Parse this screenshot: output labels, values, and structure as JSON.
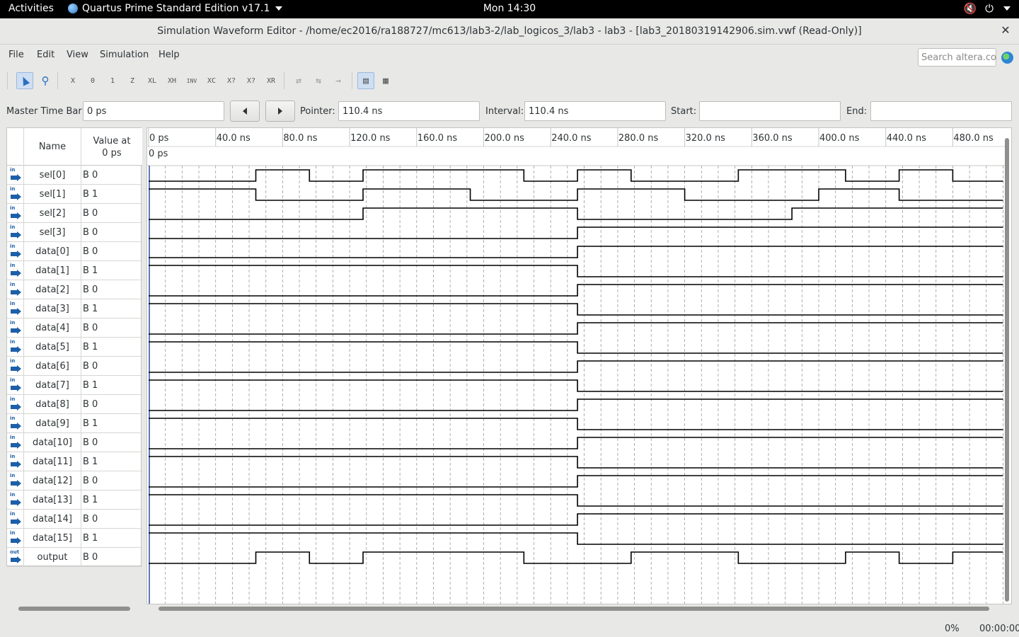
{
  "topbar": {
    "activities": "Activities",
    "app_name": "Quartus Prime Standard Edition v17.1",
    "clock": "Mon 14:30"
  },
  "window": {
    "title": "Simulation Waveform Editor - /home/ec2016/ra188727/mc613/lab3-2/lab_logicos_3/lab3 - lab3 - [lab3_20180319142906.sim.vwf (Read-Only)]",
    "close": "✕"
  },
  "menu": {
    "items": [
      "File",
      "Edit",
      "View",
      "Simulation",
      "Help"
    ],
    "search_placeholder": "Search altera.co..."
  },
  "toolbar": {
    "icons": [
      "selection-tool-icon",
      "zoom-tool-icon",
      "force-unknown-icon",
      "force-low-icon",
      "force-high-icon",
      "force-high-impedance-icon",
      "force-weak-low-icon",
      "force-weak-high-icon",
      "invert-icon",
      "count-value-icon",
      "overwrite-clock-icon",
      "random-values-icon",
      "arbitrary-value-icon",
      "snap-to-grid-icon",
      "sort-icon",
      "insert-node-icon",
      "delete-node-icon",
      "grid-options-icon"
    ],
    "glyphs": [
      "",
      "",
      "X",
      "0",
      "1",
      "Z",
      "XL",
      "XH",
      "INV",
      "XC",
      "X?",
      "X?",
      "XR",
      "⇄",
      "⇆",
      "→",
      "▤",
      "▦"
    ]
  },
  "timebar": {
    "master_label": "Master Time Bar:",
    "master_value": "0 ps",
    "pointer_label": "Pointer:",
    "pointer_value": "110.4 ns",
    "interval_label": "Interval:",
    "interval_value": "110.4 ns",
    "start_label": "Start:",
    "start_value": "",
    "end_label": "End:",
    "end_value": ""
  },
  "signal_table": {
    "name_header": "Name",
    "value_header_line1": "Value at",
    "value_header_line2": "0 ps",
    "signals": [
      {
        "dir": "in",
        "name": "sel[0]",
        "value": "B 0"
      },
      {
        "dir": "in",
        "name": "sel[1]",
        "value": "B 1"
      },
      {
        "dir": "in",
        "name": "sel[2]",
        "value": "B 0"
      },
      {
        "dir": "in",
        "name": "sel[3]",
        "value": "B 0"
      },
      {
        "dir": "in",
        "name": "data[0]",
        "value": "B 0"
      },
      {
        "dir": "in",
        "name": "data[1]",
        "value": "B 1"
      },
      {
        "dir": "in",
        "name": "data[2]",
        "value": "B 0"
      },
      {
        "dir": "in",
        "name": "data[3]",
        "value": "B 1"
      },
      {
        "dir": "in",
        "name": "data[4]",
        "value": "B 0"
      },
      {
        "dir": "in",
        "name": "data[5]",
        "value": "B 1"
      },
      {
        "dir": "in",
        "name": "data[6]",
        "value": "B 0"
      },
      {
        "dir": "in",
        "name": "data[7]",
        "value": "B 1"
      },
      {
        "dir": "in",
        "name": "data[8]",
        "value": "B 0"
      },
      {
        "dir": "in",
        "name": "data[9]",
        "value": "B 1"
      },
      {
        "dir": "in",
        "name": "data[10]",
        "value": "B 0"
      },
      {
        "dir": "in",
        "name": "data[11]",
        "value": "B 1"
      },
      {
        "dir": "in",
        "name": "data[12]",
        "value": "B 0"
      },
      {
        "dir": "in",
        "name": "data[13]",
        "value": "B 1"
      },
      {
        "dir": "in",
        "name": "data[14]",
        "value": "B 0"
      },
      {
        "dir": "in",
        "name": "data[15]",
        "value": "B 1"
      },
      {
        "dir": "out",
        "name": "output",
        "value": "B 0"
      }
    ]
  },
  "waveform": {
    "time_unit": "ns",
    "time_range": [
      0,
      510
    ],
    "ticks": [
      "0 ps",
      "40.0 ns",
      "80.0 ns",
      "120.0 ns",
      "160.0 ns",
      "200.0 ns",
      "240.0 ns",
      "280.0 ns",
      "320.0 ns",
      "360.0 ns",
      "400.0 ns",
      "440.0 ns",
      "480.0 ns"
    ],
    "tick_values": [
      0,
      40,
      80,
      120,
      160,
      200,
      240,
      280,
      320,
      360,
      400,
      440,
      480
    ],
    "master_marker_label": "0 ps",
    "grid": true,
    "traces": [
      [
        [
          0,
          0
        ],
        [
          64,
          1
        ],
        [
          96,
          0
        ],
        [
          128,
          1
        ],
        [
          224,
          0
        ],
        [
          256,
          1
        ],
        [
          288,
          0
        ],
        [
          352,
          1
        ],
        [
          416,
          0
        ],
        [
          448,
          1
        ],
        [
          480,
          0
        ]
      ],
      [
        [
          0,
          1
        ],
        [
          64,
          0
        ],
        [
          128,
          1
        ],
        [
          192,
          0
        ],
        [
          256,
          1
        ],
        [
          320,
          0
        ],
        [
          400,
          1
        ],
        [
          448,
          0
        ]
      ],
      [
        [
          0,
          0
        ],
        [
          128,
          1
        ],
        [
          256,
          0
        ],
        [
          384,
          1
        ]
      ],
      [
        [
          0,
          0
        ],
        [
          256,
          1
        ]
      ],
      [
        [
          0,
          0
        ],
        [
          256,
          1
        ]
      ],
      [
        [
          0,
          1
        ],
        [
          256,
          0
        ]
      ],
      [
        [
          0,
          0
        ],
        [
          256,
          1
        ]
      ],
      [
        [
          0,
          1
        ],
        [
          256,
          0
        ]
      ],
      [
        [
          0,
          0
        ],
        [
          256,
          1
        ]
      ],
      [
        [
          0,
          1
        ],
        [
          256,
          0
        ]
      ],
      [
        [
          0,
          0
        ],
        [
          256,
          1
        ]
      ],
      [
        [
          0,
          1
        ],
        [
          256,
          0
        ]
      ],
      [
        [
          0,
          0
        ],
        [
          256,
          1
        ]
      ],
      [
        [
          0,
          1
        ],
        [
          256,
          0
        ]
      ],
      [
        [
          0,
          0
        ],
        [
          256,
          1
        ]
      ],
      [
        [
          0,
          1
        ],
        [
          256,
          0
        ]
      ],
      [
        [
          0,
          0
        ],
        [
          256,
          1
        ]
      ],
      [
        [
          0,
          1
        ],
        [
          256,
          0
        ]
      ],
      [
        [
          0,
          0
        ],
        [
          256,
          1
        ]
      ],
      [
        [
          0,
          1
        ],
        [
          256,
          0
        ]
      ],
      [
        [
          0,
          0
        ],
        [
          64,
          1
        ],
        [
          96,
          0
        ],
        [
          128,
          1
        ],
        [
          224,
          0
        ],
        [
          288,
          1
        ],
        [
          352,
          0
        ],
        [
          416,
          1
        ],
        [
          448,
          0
        ],
        [
          480,
          1
        ]
      ]
    ]
  },
  "status": {
    "progress": "0%",
    "elapsed": "00:00:00"
  },
  "colors": {
    "wave": "#000000",
    "grid": "#9a9a9a",
    "accent": "#2b6fc1"
  }
}
